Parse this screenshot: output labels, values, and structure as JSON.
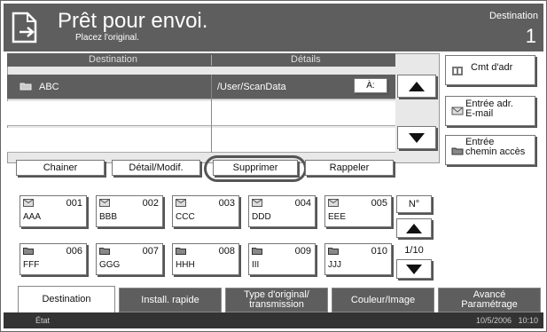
{
  "header": {
    "title": "Prêt pour envoi.",
    "subtitle": "Placez l'original.",
    "dest_label": "Destination",
    "dest_count": "1"
  },
  "table": {
    "col_destination": "Destination",
    "col_details": "Détails",
    "rows": [
      {
        "name": "ABC",
        "details": "/User/ScanData",
        "action": "À:"
      },
      {
        "name": "",
        "details": "",
        "action": ""
      },
      {
        "name": "",
        "details": "",
        "action": ""
      }
    ]
  },
  "side": {
    "addr_book": "Cmt d'adr",
    "email": "Entrée adr.\nE-mail",
    "path": "Entrée\nchemin accès"
  },
  "actions": {
    "chain": "Chainer",
    "detail": "Détail/Modif.",
    "delete": "Supprimer",
    "recall": "Rappeler"
  },
  "onetouch": [
    {
      "num": "001",
      "name": "AAA",
      "icon": "email-icon"
    },
    {
      "num": "002",
      "name": "BBB",
      "icon": "email-icon"
    },
    {
      "num": "003",
      "name": "CCC",
      "icon": "email-icon"
    },
    {
      "num": "004",
      "name": "DDD",
      "icon": "email-icon"
    },
    {
      "num": "005",
      "name": "EEE",
      "icon": "email-icon"
    },
    {
      "num": "006",
      "name": "FFF",
      "icon": "folder-icon"
    },
    {
      "num": "007",
      "name": "GGG",
      "icon": "folder-icon"
    },
    {
      "num": "008",
      "name": "HHH",
      "icon": "folder-icon"
    },
    {
      "num": "009",
      "name": "III",
      "icon": "folder-icon"
    },
    {
      "num": "010",
      "name": "JJJ",
      "icon": "folder-icon"
    }
  ],
  "paging": {
    "no_label": "N°",
    "page": "1/10"
  },
  "tabs": [
    "Destination",
    "Install. rapide",
    "Type d'original/\ntransmission",
    "Couleur/Image",
    "Avancé\nParamétrage"
  ],
  "status": {
    "label": "État",
    "datetime": "10/5/2006   10:10"
  }
}
